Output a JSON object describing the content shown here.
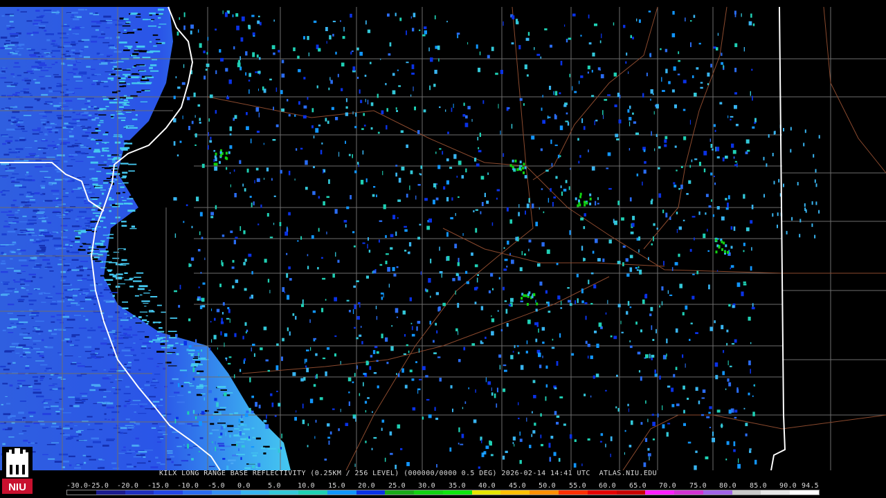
{
  "product": {
    "caption": "KILX LONG RANGE BASE REFLECTIVITY (0.25KM / 256 LEVEL) (000000/0000 0.5 DEG) 2026-02-14 14:41 UTC  ATLAS.NIU.EDU"
  },
  "logo": {
    "text": "NIU",
    "color": "#c8102e"
  },
  "scale": {
    "labels": [
      "-30.0",
      "-25.0",
      "-20.0",
      "-15.0",
      "-10.0",
      "-5.0",
      "0.0",
      "5.0",
      "10.0",
      "15.0",
      "20.0",
      "25.0",
      "30.0",
      "35.0",
      "40.0",
      "45.0",
      "50.0",
      "55.0",
      "60.0",
      "65.0",
      "70.0",
      "75.0",
      "80.0",
      "85.0",
      "90.0",
      "94.5"
    ],
    "colors": [
      "#000000",
      "#1b1b8f",
      "#1f2fbf",
      "#2346e6",
      "#2a6cf2",
      "#3490f5",
      "#38b4f0",
      "#33c8d8",
      "#1fd0b4",
      "#1296ff",
      "#0a32e6",
      "#1aaa1a",
      "#12d212",
      "#0fe60f",
      "#e6e600",
      "#ffc000",
      "#ff9000",
      "#ff3000",
      "#e60000",
      "#c80000",
      "#ff1fff",
      "#d233d2",
      "#a064e6",
      "#c8c8c8",
      "#e6e6e6",
      "#ffffff"
    ]
  },
  "colors": {
    "background": "#000000",
    "county_lines": "#6e6e6e",
    "state_lines": "#ffffff",
    "roads": "#8b4a2e",
    "clear_air_echo": "#2a6cf2"
  }
}
